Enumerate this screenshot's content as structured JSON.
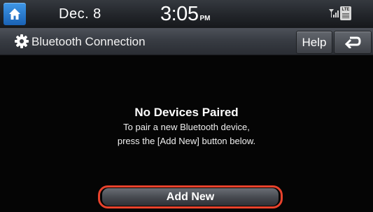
{
  "status_bar": {
    "home_icon": "home-icon",
    "date": "Dec.  8",
    "time": "3:05",
    "ampm": "PM",
    "signal_icon": "signal-icon",
    "lte_label": "LTE"
  },
  "title_bar": {
    "icon": "gear-icon",
    "title": "Bluetooth Connection",
    "help_label": "Help",
    "back_icon": "back-arrow-icon"
  },
  "message": {
    "title": "No Devices Paired",
    "line1": "To pair a new Bluetooth device,",
    "line2": "press the [Add New] button below."
  },
  "add_new_button": {
    "label": "Add New"
  },
  "colors": {
    "home_button": "#2a7fd4",
    "highlight_ring": "#e8422c",
    "background": "#050505"
  }
}
